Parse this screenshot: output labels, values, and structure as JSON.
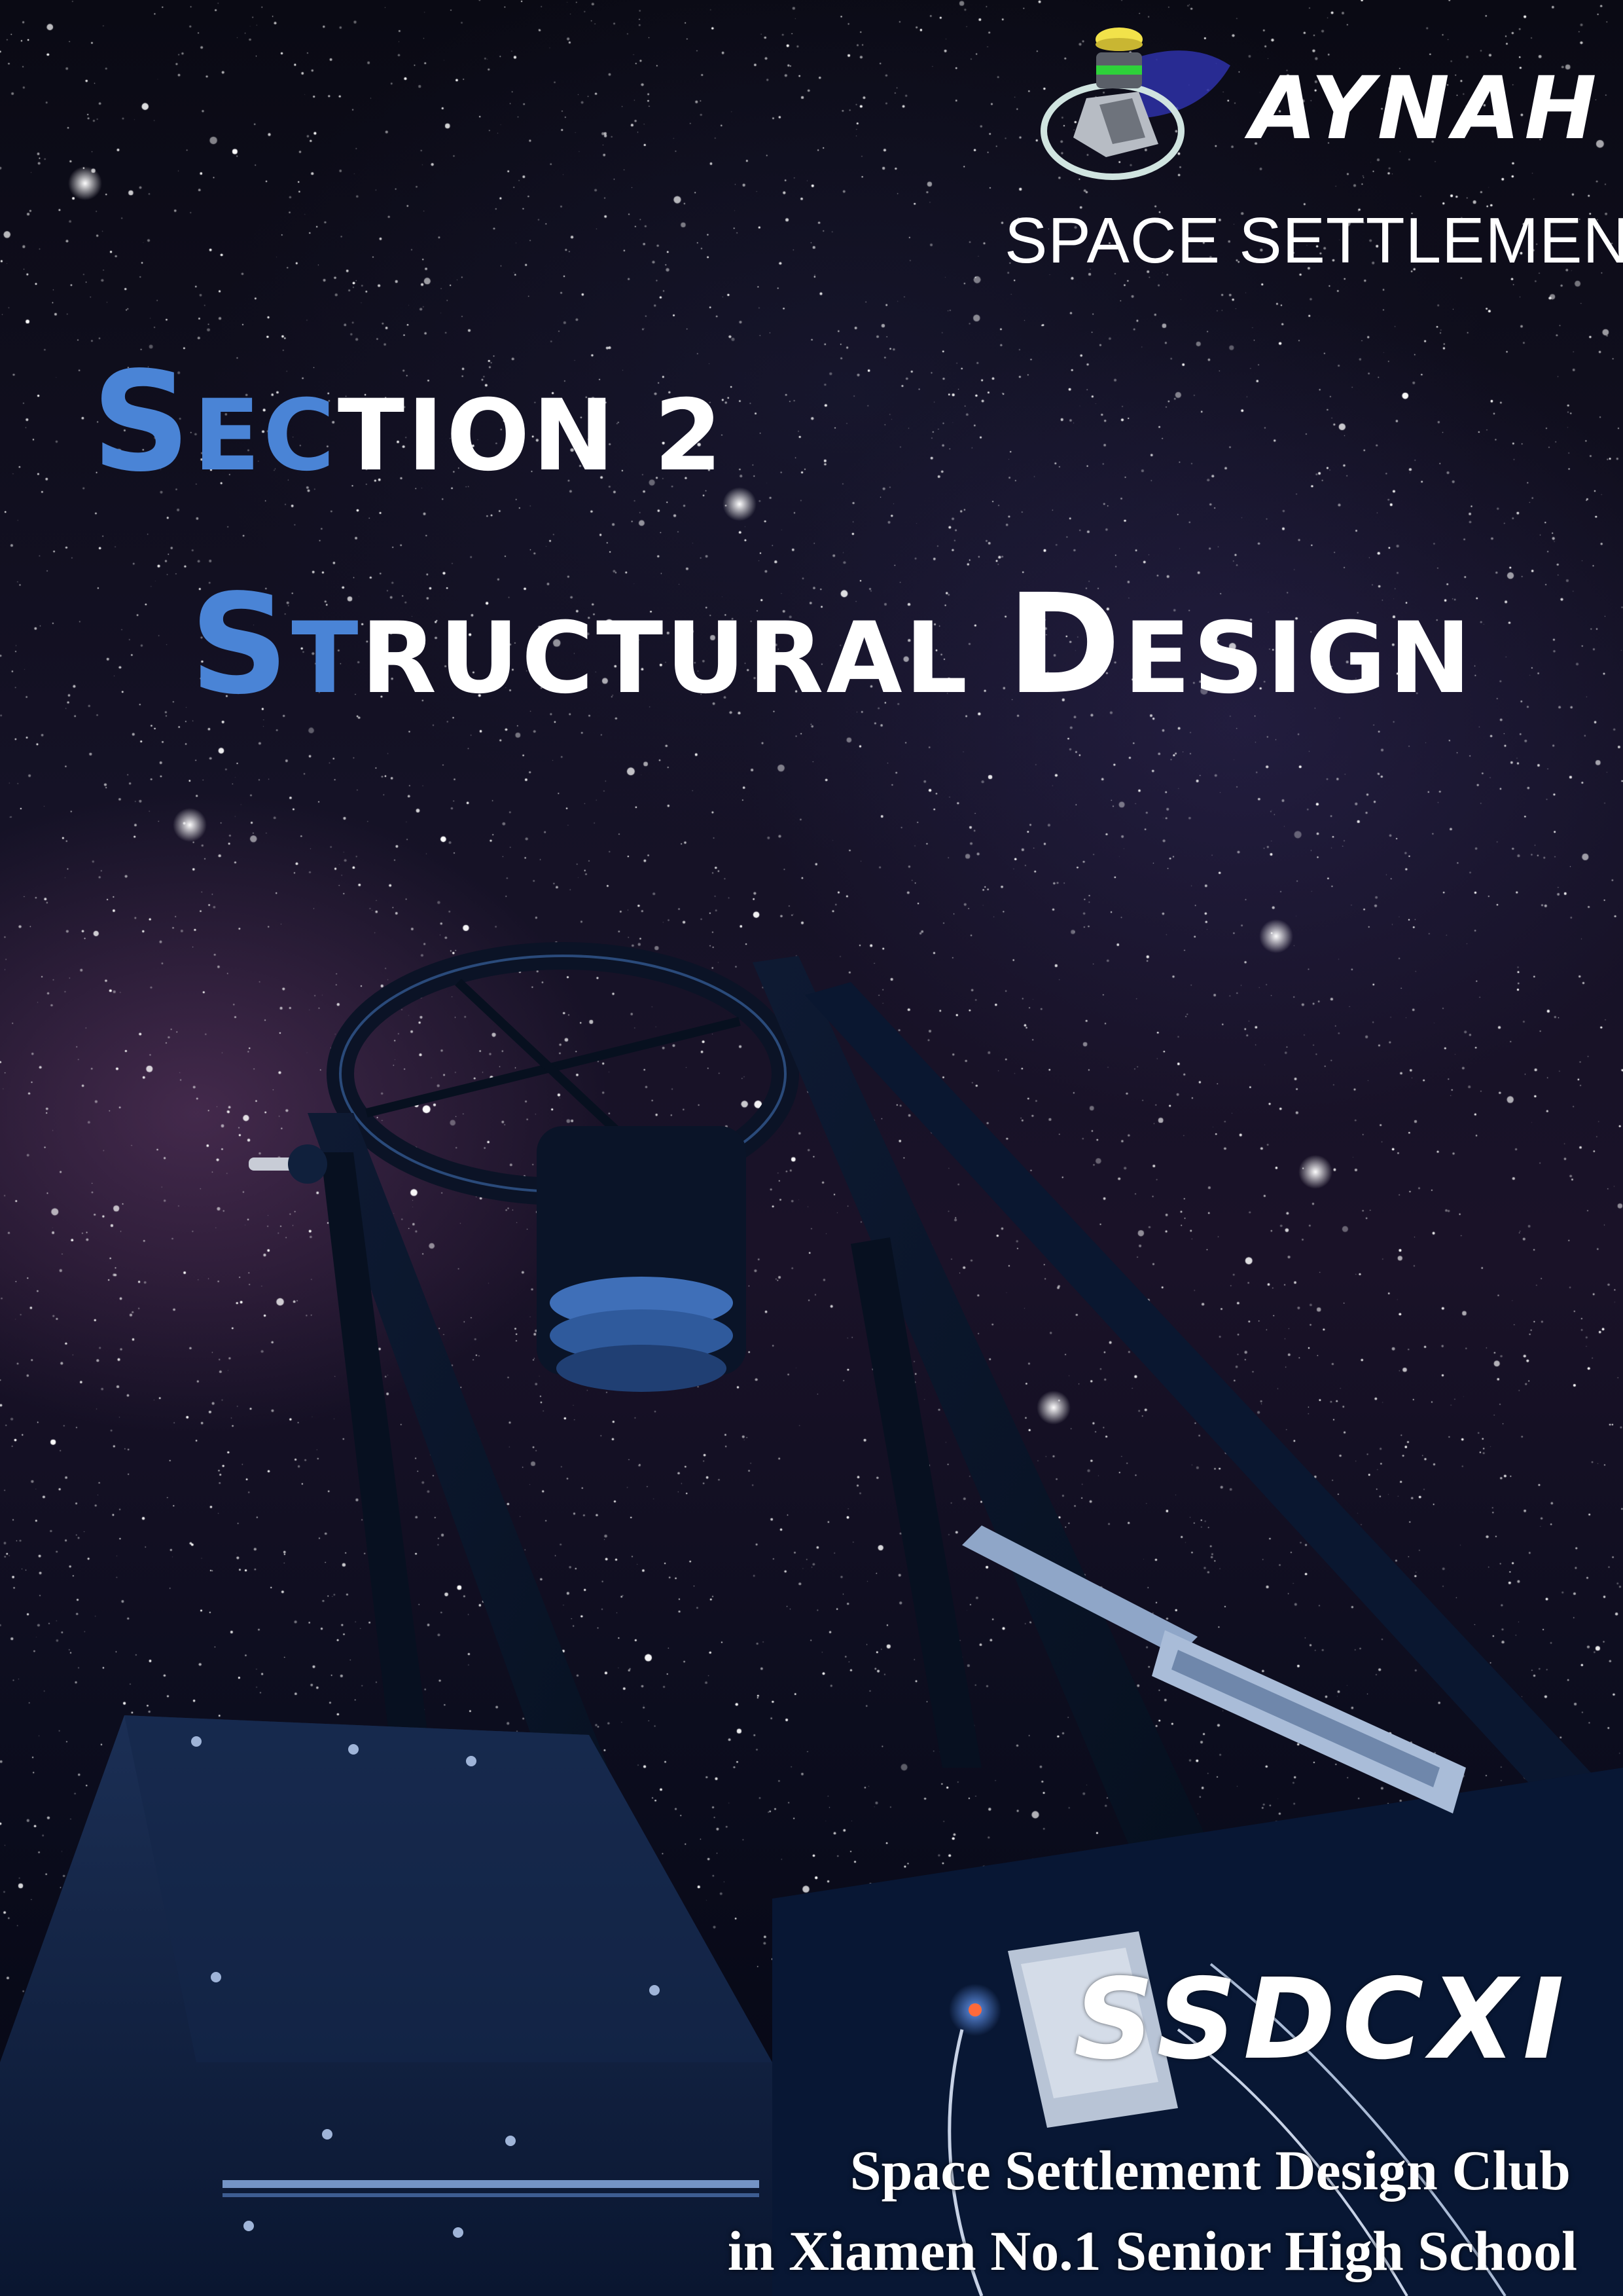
{
  "logo": {
    "icon_name": "space-settlement-emblem-icon",
    "name": "AYNAH",
    "subtitle": "SPACE SETTLEMENT"
  },
  "heading": {
    "line1": {
      "cap": "S",
      "blue_rest": "EC",
      "white_rest": "TION 2"
    },
    "line2": {
      "cap": "S",
      "blue_rest": "T",
      "white_rest": "RUCTURAL",
      "cap2": "D",
      "white_rest2": "ESIGN"
    }
  },
  "footer": {
    "code": "SSDCXI",
    "club_line1": "Space Settlement Design Club",
    "club_line2": "in Xiamen No.1 Senior High School"
  },
  "colors": {
    "accent_blue": "#4a84d6",
    "text": "#ffffff",
    "sky_dark": "#0a0a14"
  }
}
